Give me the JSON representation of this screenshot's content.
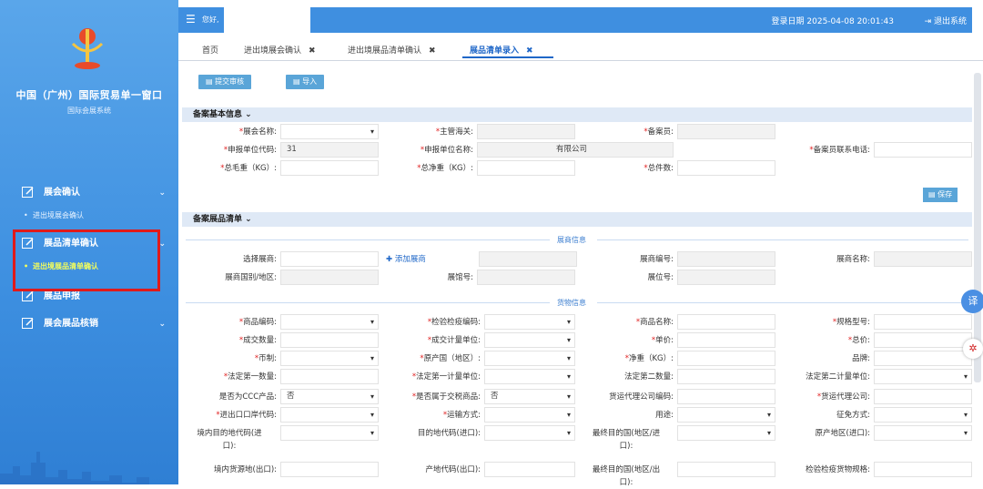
{
  "sidebar": {
    "title": "中国（广州）国际贸易单一窗口",
    "subtitle": "国际会展系统",
    "menu": [
      {
        "label": "展会确认",
        "sub": [
          "进出境展会确认"
        ]
      },
      {
        "label": "展品清单确认",
        "sub": [
          "进出境展品清单确认"
        ]
      },
      {
        "label": "展品申报"
      },
      {
        "label": "展会展品核销"
      }
    ]
  },
  "topbar": {
    "hello": "您好,",
    "login_time": "登录日期 2025-04-08 20:01:43",
    "logout": "退出系统"
  },
  "tabs": [
    {
      "label": "首页"
    },
    {
      "label": "进出境展会确认"
    },
    {
      "label": "进出境展品清单确认"
    },
    {
      "label": "展品清单录入"
    }
  ],
  "toolbar": {
    "submit": "提交审核",
    "import": "导入"
  },
  "section1": {
    "title": "备案基本信息",
    "fields": {
      "exhibition_name": "展会名称:",
      "customs": "主管海关:",
      "filer": "备案员:",
      "declarer_code": "申报单位代码:",
      "declarer_code_value": "31",
      "declarer_name": "申报单位名称:",
      "declarer_name_value": "有限公司",
      "filer_phone": "备案员联系电话:",
      "gross_weight": "总毛重（KG）:",
      "net_weight": "总净重（KG）:",
      "total_pieces": "总件数:"
    },
    "save": "保存"
  },
  "section2": {
    "title": "备案展品清单",
    "exhibitor_info": "展商信息",
    "exhibitor": {
      "select": "选择展商:",
      "add": "添加展商",
      "code": "展商编号:",
      "name": "展商名称:",
      "country": "展商国别/地区:",
      "hall": "展馆号:",
      "booth": "展位号:"
    },
    "goods_info": "货物信息",
    "goods": {
      "code": "商品编码:",
      "cic_code": "检验检疫编码:",
      "name": "商品名称:",
      "spec": "规格型号:",
      "qty": "成交数量:",
      "unit": "成交计量单位:",
      "price": "单价:",
      "total": "总价:",
      "currency": "币制:",
      "origin": "原产国（地区）:",
      "net_kg": "净重（KG）:",
      "brand": "品牌:",
      "first_qty": "法定第一数量:",
      "first_unit": "法定第一计量单位:",
      "second_qty": "法定第二数量:",
      "second_unit": "法定第二计量单位:",
      "ccc": "是否为CCC产品:",
      "ccc_value": "否",
      "duty": "是否属于交税商品:",
      "duty_value": "否",
      "agent_code": "货运代理公司编码:",
      "agent": "货运代理公司:",
      "port": "进出口口岸代码:",
      "transport": "运输方式:",
      "usage": "用途:",
      "levy": "征免方式:",
      "dest_code_1": "境内目的地代码(进",
      "dest_code_2": "口):",
      "dest_import": "目的地代码(进口):",
      "final_dest_1": "最终目的国(地区/进",
      "final_dest_2": "口):",
      "origin_import": "原产地区(进口):",
      "src_export": "境内货源地(出口):",
      "prod_code": "产地代码(出口):",
      "final_export_1": "最终目的国(地区/出",
      "final_export_2": "口):",
      "cic_spec": "检验检疫货物规格:"
    }
  },
  "float": {
    "translate": "译"
  }
}
